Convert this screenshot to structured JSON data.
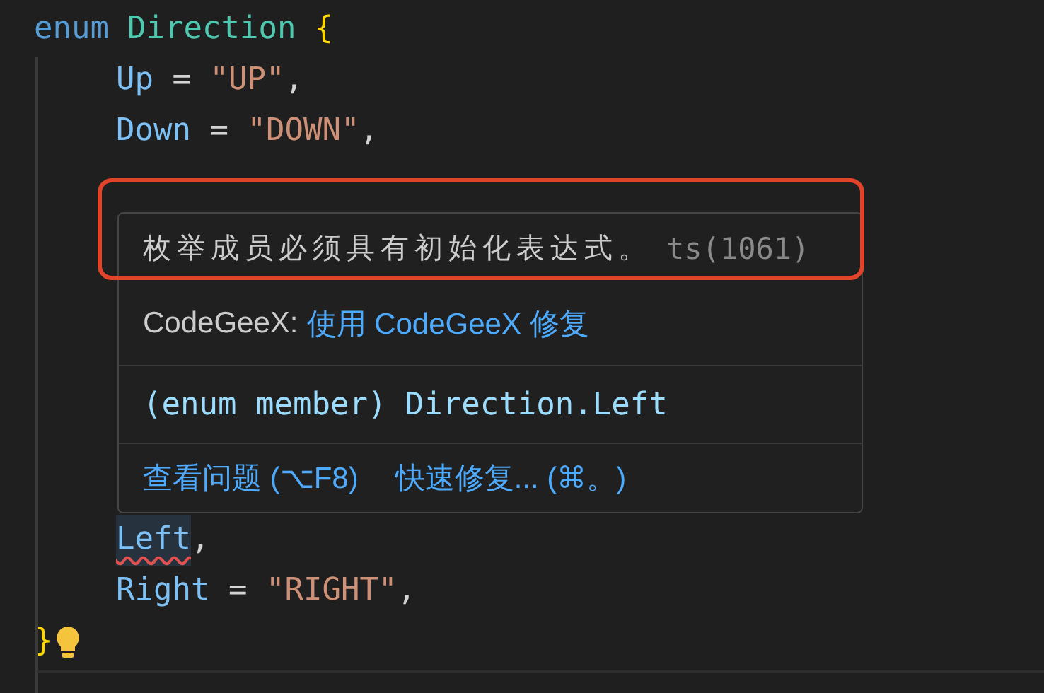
{
  "code_lines": [
    {
      "kind": "decl",
      "tokens": [
        {
          "text": "enum",
          "kind": "keyword"
        },
        {
          "text": "Direction",
          "kind": "type"
        },
        {
          "text": "{",
          "kind": "brace"
        }
      ]
    },
    {
      "kind": "body",
      "tokens": [
        {
          "text": "Up",
          "kind": "member"
        },
        {
          "text": " = ",
          "kind": "plain"
        },
        {
          "text": "\"UP\"",
          "kind": "string"
        },
        {
          "text": ",",
          "kind": "plain"
        }
      ]
    },
    {
      "kind": "body",
      "tokens": [
        {
          "text": "Down",
          "kind": "member"
        },
        {
          "text": " = ",
          "kind": "plain"
        },
        {
          "text": "\"DOWN\"",
          "kind": "string"
        },
        {
          "text": ",",
          "kind": "plain"
        }
      ]
    }
  ],
  "hover": {
    "message": "枚举成员必须具有初始化表达式。",
    "code": "ts(1061)",
    "highlighted": true,
    "ai_prefix": "CodeGeeX:",
    "ai_link": "使用 CodeGeeX 修复",
    "signature": "(enum member) Direction.Left",
    "actions": [
      "查看问题 (⌥F8)",
      "快速修复... (⌘。)"
    ]
  },
  "code_lines_after": [
    {
      "kind": "body",
      "tokens": [
        {
          "text": "Left",
          "kind": "member",
          "error": true
        },
        {
          "text": ",",
          "kind": "plain"
        }
      ]
    },
    {
      "kind": "body",
      "tokens": [
        {
          "text": "Right",
          "kind": "member"
        },
        {
          "text": " = ",
          "kind": "plain"
        },
        {
          "text": "\"RIGHT\"",
          "kind": "string"
        },
        {
          "text": ",",
          "kind": "plain"
        }
      ]
    },
    {
      "kind": "decl",
      "tokens": [
        {
          "text": "}",
          "kind": "brace"
        }
      ],
      "lightbulb": true
    }
  ]
}
